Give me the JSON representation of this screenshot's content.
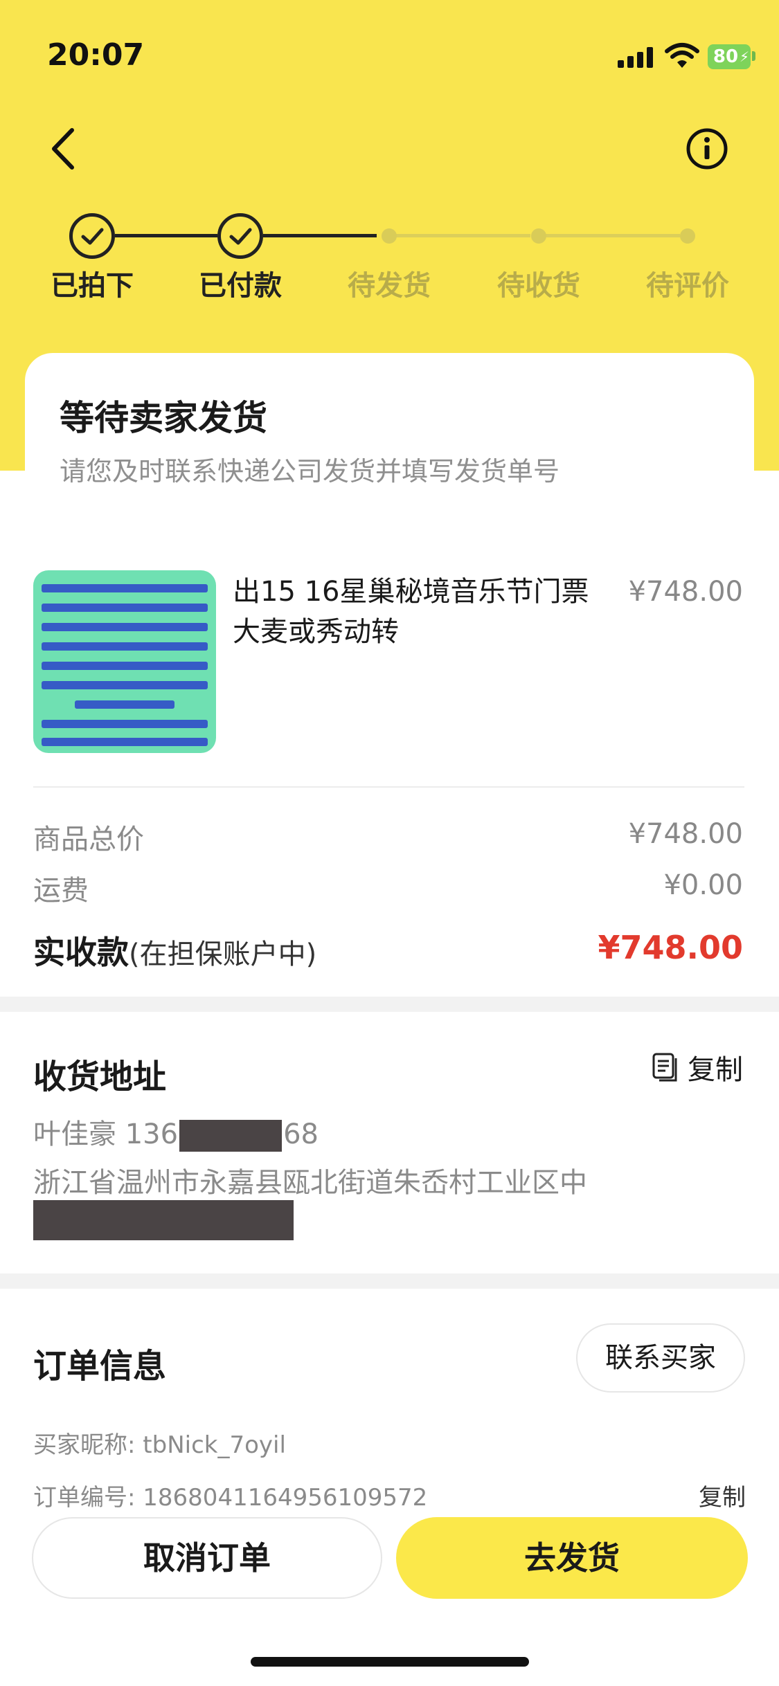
{
  "status_bar": {
    "time": "20:07",
    "battery": "80"
  },
  "progress": {
    "steps": [
      {
        "label": "已拍下",
        "done": true
      },
      {
        "label": "已付款",
        "done": true
      },
      {
        "label": "待发货",
        "done": false
      },
      {
        "label": "待收货",
        "done": false
      },
      {
        "label": "待评价",
        "done": false
      }
    ]
  },
  "status_card": {
    "title": "等待卖家发货",
    "subtitle": "请您及时联系快递公司发货并填写发货单号"
  },
  "product": {
    "title": "出15 16星巢秘境音乐节门票大麦或秀动转",
    "price": "¥748.00"
  },
  "summary": {
    "goods_total_label": "商品总价",
    "goods_total_value": "¥748.00",
    "shipping_label": "运费",
    "shipping_value": "¥0.00",
    "received_label": "实收款",
    "received_note": "(在担保账户中)",
    "received_value": "¥748.00"
  },
  "address": {
    "title": "收货地址",
    "copy_label": "复制",
    "name": "叶佳豪",
    "phone_prefix": "136",
    "phone_suffix": "68",
    "line": "浙江省温州市永嘉县瓯北街道朱岙村工业区中"
  },
  "order_info": {
    "title": "订单信息",
    "contact_label": "联系买家",
    "buyer_nick_label": "买家昵称:",
    "buyer_nick": "tbNick_7oyil",
    "order_no_label": "订单编号:",
    "order_no": "1868041164956109572",
    "copy_label": "复制"
  },
  "actions": {
    "cancel_label": "取消订单",
    "ship_label": "去发货"
  },
  "colors": {
    "brand_yellow": "#f9e54f",
    "price_red": "#e23a2d"
  },
  "icons": {
    "back": "chevron-left-icon",
    "info": "info-circle-icon",
    "copy": "copy-icon",
    "check": "check-icon"
  }
}
